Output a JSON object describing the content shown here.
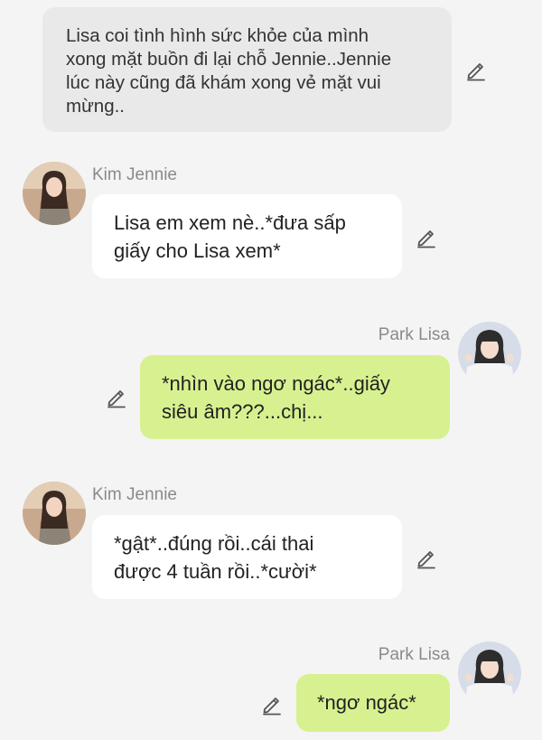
{
  "narration": {
    "text": "Lisa coi tình hình sức khỏe của mình\nxong mặt buồn đi lại chỗ Jennie..Jennie\nlúc này cũng đã khám xong vẻ mặt vui\nmừng.."
  },
  "messages": [
    {
      "sender": "Kim Jennie",
      "side": "left",
      "text": "Lisa em xem nè..*đưa sấp\ngiấy cho Lisa xem*"
    },
    {
      "sender": "Park Lisa",
      "side": "right",
      "text": "*nhìn vào ngơ ngác*..giấy\nsiêu âm???...chị..."
    },
    {
      "sender": "Kim Jennie",
      "side": "left",
      "text": "*gật*..đúng rồi..cái thai\nđược 4 tuần rồi..*cười*"
    },
    {
      "sender": "Park Lisa",
      "side": "right",
      "text": "*ngơ ngác*"
    }
  ],
  "icons": {
    "edit": "pencil-edit-icon"
  },
  "colors": {
    "background": "#f4f4f4",
    "narration_bg": "#e9e9e9",
    "left_bubble": "#ffffff",
    "right_bubble": "#d7f190",
    "name_text": "#8a8a8a"
  }
}
